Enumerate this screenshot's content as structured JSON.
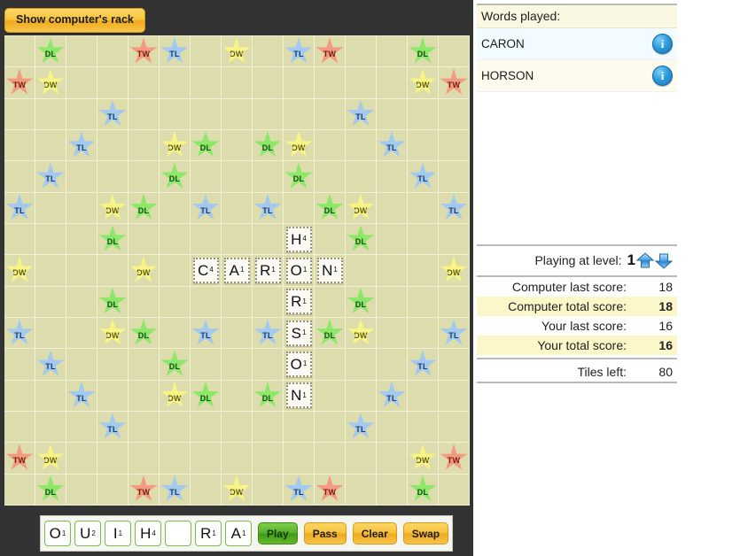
{
  "toolbar": {
    "show_rack_label": "Show computer's rack"
  },
  "board": {
    "size": 15,
    "premium_labels": {
      "dl": "DL",
      "tl": "TL",
      "dw": "DW",
      "tw": "TW"
    },
    "premiums": [
      {
        "r": 0,
        "c": 1,
        "t": "dl"
      },
      {
        "r": 0,
        "c": 4,
        "t": "tw"
      },
      {
        "r": 0,
        "c": 5,
        "t": "tl"
      },
      {
        "r": 0,
        "c": 7,
        "t": "dw"
      },
      {
        "r": 0,
        "c": 9,
        "t": "tl"
      },
      {
        "r": 0,
        "c": 10,
        "t": "tw"
      },
      {
        "r": 0,
        "c": 13,
        "t": "dl"
      },
      {
        "r": 1,
        "c": 0,
        "t": "tw"
      },
      {
        "r": 1,
        "c": 1,
        "t": "dw"
      },
      {
        "r": 1,
        "c": 13,
        "t": "dw"
      },
      {
        "r": 1,
        "c": 14,
        "t": "tw"
      },
      {
        "r": 2,
        "c": 3,
        "t": "tl"
      },
      {
        "r": 2,
        "c": 11,
        "t": "tl"
      },
      {
        "r": 3,
        "c": 2,
        "t": "tl"
      },
      {
        "r": 3,
        "c": 5,
        "t": "dw"
      },
      {
        "r": 3,
        "c": 6,
        "t": "dl"
      },
      {
        "r": 3,
        "c": 8,
        "t": "dl"
      },
      {
        "r": 3,
        "c": 9,
        "t": "dw"
      },
      {
        "r": 3,
        "c": 12,
        "t": "tl"
      },
      {
        "r": 4,
        "c": 1,
        "t": "tl"
      },
      {
        "r": 4,
        "c": 5,
        "t": "dl"
      },
      {
        "r": 4,
        "c": 9,
        "t": "dl"
      },
      {
        "r": 4,
        "c": 13,
        "t": "tl"
      },
      {
        "r": 5,
        "c": 0,
        "t": "tl"
      },
      {
        "r": 5,
        "c": 3,
        "t": "dw"
      },
      {
        "r": 5,
        "c": 4,
        "t": "dl"
      },
      {
        "r": 5,
        "c": 6,
        "t": "tl"
      },
      {
        "r": 5,
        "c": 8,
        "t": "tl"
      },
      {
        "r": 5,
        "c": 10,
        "t": "dl"
      },
      {
        "r": 5,
        "c": 11,
        "t": "dw"
      },
      {
        "r": 5,
        "c": 14,
        "t": "tl"
      },
      {
        "r": 6,
        "c": 3,
        "t": "dl"
      },
      {
        "r": 6,
        "c": 11,
        "t": "dl"
      },
      {
        "r": 7,
        "c": 0,
        "t": "dw"
      },
      {
        "r": 7,
        "c": 4,
        "t": "dw"
      },
      {
        "r": 7,
        "c": 14,
        "t": "dw"
      },
      {
        "r": 8,
        "c": 3,
        "t": "dl"
      },
      {
        "r": 8,
        "c": 11,
        "t": "dl"
      },
      {
        "r": 9,
        "c": 0,
        "t": "tl"
      },
      {
        "r": 9,
        "c": 3,
        "t": "dw"
      },
      {
        "r": 9,
        "c": 4,
        "t": "dl"
      },
      {
        "r": 9,
        "c": 6,
        "t": "tl"
      },
      {
        "r": 9,
        "c": 8,
        "t": "tl"
      },
      {
        "r": 9,
        "c": 10,
        "t": "dl"
      },
      {
        "r": 9,
        "c": 11,
        "t": "dw"
      },
      {
        "r": 9,
        "c": 14,
        "t": "tl"
      },
      {
        "r": 10,
        "c": 1,
        "t": "tl"
      },
      {
        "r": 10,
        "c": 5,
        "t": "dl"
      },
      {
        "r": 10,
        "c": 9,
        "t": "dl"
      },
      {
        "r": 10,
        "c": 13,
        "t": "tl"
      },
      {
        "r": 11,
        "c": 2,
        "t": "tl"
      },
      {
        "r": 11,
        "c": 5,
        "t": "dw"
      },
      {
        "r": 11,
        "c": 6,
        "t": "dl"
      },
      {
        "r": 11,
        "c": 8,
        "t": "dl"
      },
      {
        "r": 11,
        "c": 12,
        "t": "tl"
      },
      {
        "r": 12,
        "c": 3,
        "t": "tl"
      },
      {
        "r": 12,
        "c": 11,
        "t": "tl"
      },
      {
        "r": 13,
        "c": 0,
        "t": "tw"
      },
      {
        "r": 13,
        "c": 1,
        "t": "dw"
      },
      {
        "r": 13,
        "c": 13,
        "t": "dw"
      },
      {
        "r": 13,
        "c": 14,
        "t": "tw"
      },
      {
        "r": 14,
        "c": 1,
        "t": "dl"
      },
      {
        "r": 14,
        "c": 4,
        "t": "tw"
      },
      {
        "r": 14,
        "c": 5,
        "t": "tl"
      },
      {
        "r": 14,
        "c": 7,
        "t": "dw"
      },
      {
        "r": 14,
        "c": 9,
        "t": "tl"
      },
      {
        "r": 14,
        "c": 10,
        "t": "tw"
      },
      {
        "r": 14,
        "c": 13,
        "t": "dl"
      }
    ],
    "tiles": [
      {
        "r": 6,
        "c": 9,
        "letter": "H",
        "points": "4"
      },
      {
        "r": 7,
        "c": 6,
        "letter": "C",
        "points": "4"
      },
      {
        "r": 7,
        "c": 7,
        "letter": "A",
        "points": "1"
      },
      {
        "r": 7,
        "c": 8,
        "letter": "R",
        "points": "1"
      },
      {
        "r": 7,
        "c": 9,
        "letter": "O",
        "points": "1"
      },
      {
        "r": 7,
        "c": 10,
        "letter": "N",
        "points": "1"
      },
      {
        "r": 8,
        "c": 9,
        "letter": "R",
        "points": "1"
      },
      {
        "r": 9,
        "c": 9,
        "letter": "S",
        "points": "1"
      },
      {
        "r": 10,
        "c": 9,
        "letter": "O",
        "points": "1"
      },
      {
        "r": 11,
        "c": 9,
        "letter": "N",
        "points": "1"
      }
    ]
  },
  "rack": {
    "tiles": [
      {
        "letter": "O",
        "points": "1"
      },
      {
        "letter": "U",
        "points": "2"
      },
      {
        "letter": "I",
        "points": "1"
      },
      {
        "letter": "H",
        "points": "4"
      },
      {
        "letter": "",
        "points": ""
      },
      {
        "letter": "R",
        "points": "1"
      },
      {
        "letter": "A",
        "points": "1"
      }
    ],
    "buttons": [
      {
        "label": "Play",
        "style": "green"
      },
      {
        "label": "Pass",
        "style": "orange"
      },
      {
        "label": "Clear",
        "style": "orange"
      },
      {
        "label": "Swap",
        "style": "orange"
      }
    ]
  },
  "sidebar": {
    "words_header": "Words played:",
    "words": [
      {
        "word": "CARON",
        "info": "i"
      },
      {
        "word": "HORSON",
        "info": "i"
      }
    ],
    "level": {
      "label": "Playing at level:",
      "value": "1",
      "up_icon": "arrow-up",
      "down_icon": "arrow-down"
    },
    "scores": [
      {
        "label": "Computer last score:",
        "value": "18",
        "highlight": false
      },
      {
        "label": "Computer total score:",
        "value": "18",
        "highlight": true
      },
      {
        "label": "Your last score:",
        "value": "16",
        "highlight": false
      },
      {
        "label": "Your total score:",
        "value": "16",
        "highlight": true
      },
      {
        "label": "Tiles left:",
        "value": "80",
        "highlight": false
      }
    ]
  },
  "colors": {
    "board_bg": "#dcdcac",
    "dl": "#8de86a",
    "tl": "#a3c9ef",
    "dw": "#f8f486",
    "tw": "#f39b80",
    "accent_orange": "#f8c33c",
    "accent_green": "#56b02a",
    "highlight_yellow": "#fbf7c9"
  }
}
